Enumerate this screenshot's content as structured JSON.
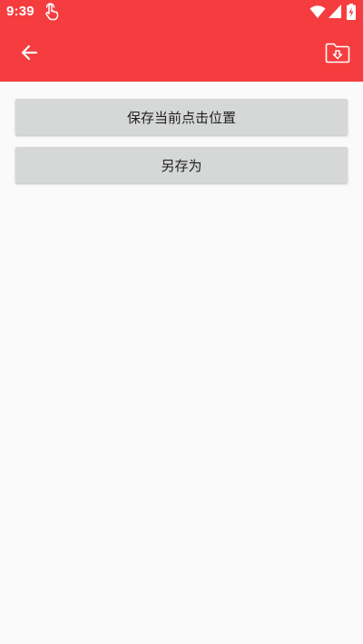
{
  "status_bar": {
    "time": "9:39",
    "icons": [
      "touch-icon",
      "wifi-icon",
      "signal-icon",
      "battery-icon"
    ]
  },
  "app_bar": {
    "background": "#f53d3f",
    "back_icon": "arrow-left-icon",
    "action_icon": "folder-download-icon"
  },
  "actions": {
    "save_current_label": "保存当前点击位置",
    "save_as_label": "另存为"
  },
  "colors": {
    "accent": "#f53d3f",
    "button_bg": "#d6d7d7",
    "page_bg": "#fafafa"
  }
}
